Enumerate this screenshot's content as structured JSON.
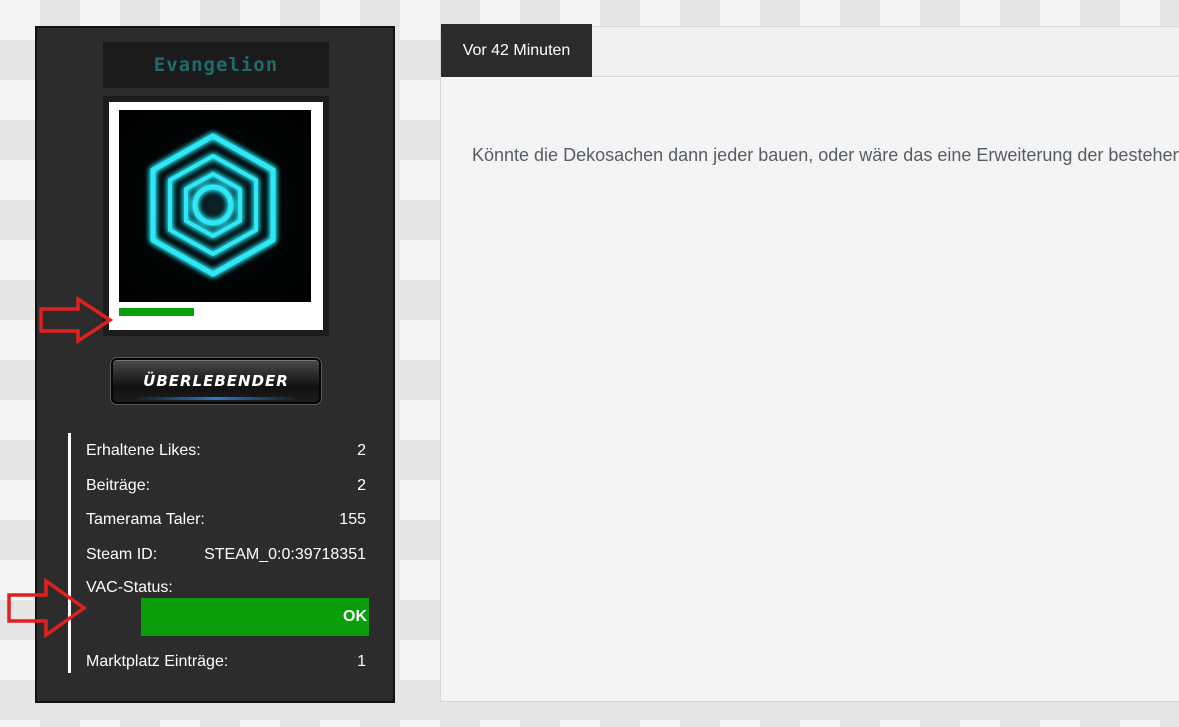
{
  "user": {
    "name": "Evangelion",
    "rank": "ÜBERLEBENDER"
  },
  "stats": [
    {
      "label": "Erhaltene Likes:",
      "value": "2"
    },
    {
      "label": "Beiträge:",
      "value": "2"
    },
    {
      "label": "Tamerama Taler:",
      "value": "155"
    },
    {
      "label": "Steam ID:",
      "value": "STEAM_0:0:39718351"
    },
    {
      "label": "VAC-Status:",
      "value": ""
    },
    {
      "label": "Marktplatz Einträge:",
      "value": "1"
    }
  ],
  "vac": {
    "status": "OK",
    "color": "#0a9e0a"
  },
  "post": {
    "time": "Vor 42 Minuten",
    "text": "Könnte die Dekosachen dann jeder bauen, oder wäre das eine Erweiterung der bestehende"
  },
  "colors": {
    "online": "#0a9e0a",
    "username": "#1e6b6b",
    "card_bg": "#2c2c2c",
    "annotation": "#e02020",
    "avatar_glow": "#2ee8f5"
  },
  "icons": {
    "avatar": "neon-hexagon-icon",
    "annotation": "red-arrow-icon"
  }
}
